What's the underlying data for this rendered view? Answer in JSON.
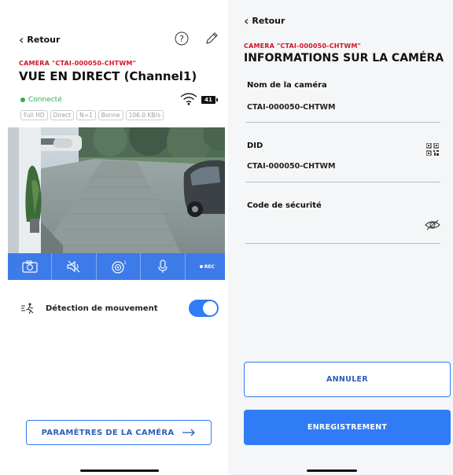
{
  "left": {
    "back_label": "Retour",
    "camera_tag": "CAMERA \"CTAI-000050-CHTWM\"",
    "title": "VUE EN DIRECT  (Channel1)",
    "status": "Connecté",
    "chips": [
      "Full HD",
      "Direct",
      "N=1",
      "Bonne",
      "106.0 KB/s"
    ],
    "battery": "41",
    "toolbar": {
      "rec_label": "REC",
      "badge": "1"
    },
    "motion_label": "Détection de mouvement",
    "motion_enabled": true,
    "settings_button": "PARAMÈTRES DE LA CAMÉRA"
  },
  "right": {
    "back_label": "Retour",
    "camera_tag": "CAMERA \"CTAI-000050-CHTWM\"",
    "title": "INFORMATIONS SUR LA CAMÉRA",
    "fields": [
      {
        "label": "Nom de la caméra",
        "value": "CTAI-000050-CHTWM"
      },
      {
        "label": "DID",
        "value": "CTAI-000050-CHTWM"
      },
      {
        "label": "Code de sécurité",
        "value": ""
      }
    ],
    "cancel_button": "ANNULER",
    "save_button": "ENREGISTREMENT"
  },
  "colors": {
    "accent": "#2f7cf6",
    "toolbar": "#3d7be8",
    "tag_red": "#d4122a",
    "status_green": "#2bb24c"
  }
}
